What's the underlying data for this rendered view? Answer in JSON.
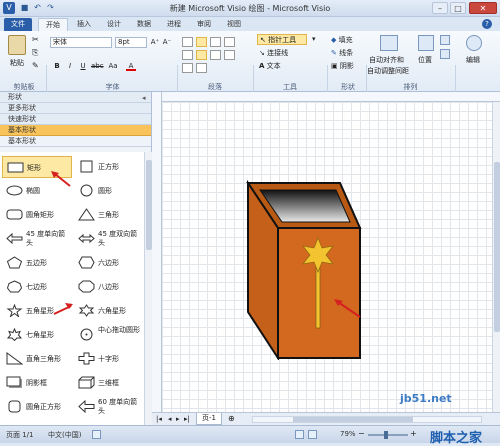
{
  "window": {
    "title": "新建 Microsoft Visio 绘图 - Microsoft Visio"
  },
  "tabs": [
    "文件",
    "开始",
    "插入",
    "设计",
    "数据",
    "进程",
    "审阅",
    "视图"
  ],
  "ribbon": {
    "clipboard": {
      "paste": "粘贴",
      "label": "剪贴板"
    },
    "font": {
      "name": "宋体",
      "size": "8pt",
      "label": "字体"
    },
    "paragraph": {
      "label": "段落"
    },
    "tools": {
      "pointer": "指针工具",
      "connector": "连接线",
      "text": "文本",
      "label": "工具"
    },
    "shape": {
      "fill": "填充",
      "line": "线条",
      "shadow": "阴影",
      "label": "形状"
    },
    "arrange": {
      "auto_align": "自动对齐和",
      "auto_space": "自动调整间距",
      "position": "位置",
      "label": "排列"
    },
    "editing": {
      "label": "编辑"
    }
  },
  "panel": {
    "header": "形状",
    "more_shapes": "更多形状",
    "quick_shapes": "快速形状",
    "basic_shapes_selected": "基本形状",
    "stencil_title": "基本形状",
    "shapes": [
      {
        "label": "矩形",
        "icon": "rectangle-icon",
        "highlighted": true
      },
      {
        "label": "正方形",
        "icon": "square-icon"
      },
      {
        "label": "椭圆",
        "icon": "ellipse-icon"
      },
      {
        "label": "圆形",
        "icon": "circle-icon"
      },
      {
        "label": "圆角矩形",
        "icon": "rounded-rectangle-icon"
      },
      {
        "label": "三角形",
        "icon": "triangle-icon"
      },
      {
        "label": "45 度单向箭头",
        "icon": "single-arrow-icon"
      },
      {
        "label": "45 度双向箭头",
        "icon": "double-arrow-icon"
      },
      {
        "label": "五边形",
        "icon": "pentagon-icon"
      },
      {
        "label": "六边形",
        "icon": "hexagon-icon"
      },
      {
        "label": "七边形",
        "icon": "heptagon-icon"
      },
      {
        "label": "八边形",
        "icon": "octagon-icon"
      },
      {
        "label": "五角星形",
        "icon": "star5-icon"
      },
      {
        "label": "六角星形",
        "icon": "star6-icon"
      },
      {
        "label": "七角星形",
        "icon": "star7-icon"
      },
      {
        "label": "中心拖动圆形",
        "icon": "center-drag-circle-icon"
      },
      {
        "label": "直角三角形",
        "icon": "right-triangle-icon"
      },
      {
        "label": "十字形",
        "icon": "cross-icon"
      },
      {
        "label": "阴影框",
        "icon": "shadow-box-icon"
      },
      {
        "label": "三维框",
        "icon": "3d-box-icon"
      },
      {
        "label": "圆角正方形",
        "icon": "rounded-square-icon"
      },
      {
        "label": "60 度单向箭头",
        "icon": "arrow60-icon"
      }
    ]
  },
  "pagebar": {
    "page_tab": "页-1"
  },
  "status": {
    "page": "页面 1/1",
    "language": "中文(中国)",
    "zoom": "79%"
  },
  "watermark": {
    "site": "jb51.net",
    "brand": "脚本之家"
  },
  "colors": {
    "box_orange": "#d2691e",
    "star_yellow": "#f4c430",
    "accent_blue": "#2b5ea8"
  }
}
